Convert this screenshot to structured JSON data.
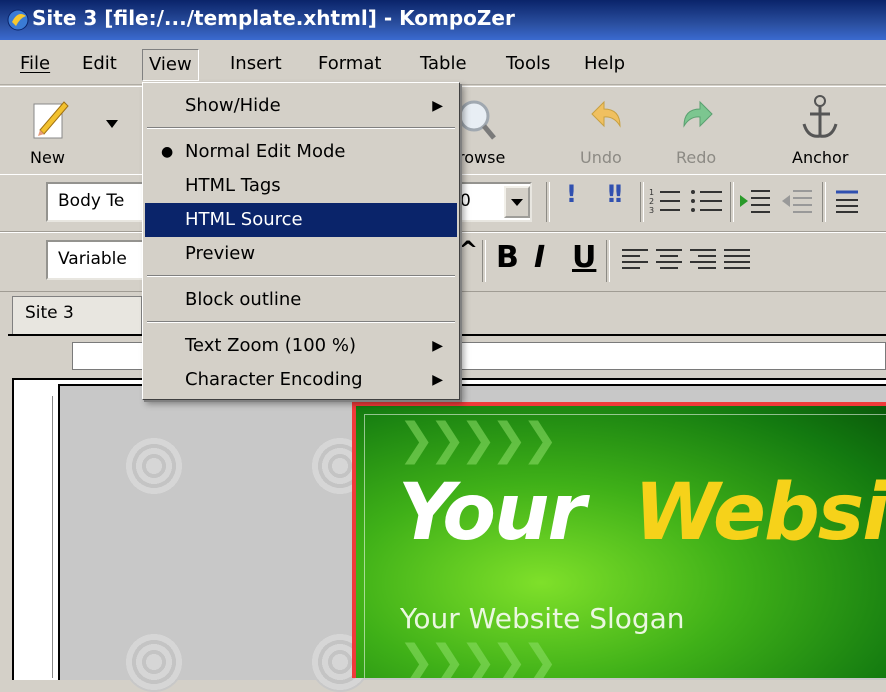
{
  "window": {
    "title": "Site 3 [file:/.../template.xhtml] - KompoZer"
  },
  "menubar": {
    "items": [
      {
        "label": "File",
        "key": "F"
      },
      {
        "label": "Edit",
        "key": "E"
      },
      {
        "label": "View",
        "key": "V"
      },
      {
        "label": "Insert",
        "key": "I"
      },
      {
        "label": "Format",
        "key": "o"
      },
      {
        "label": "Table",
        "key": "b"
      },
      {
        "label": "Tools",
        "key": "T"
      },
      {
        "label": "Help",
        "key": "H"
      }
    ]
  },
  "toolbar": {
    "new_label": "New",
    "browse_label": "rowse",
    "undo_label": "Undo",
    "redo_label": "Redo",
    "anchor_label": "Anchor"
  },
  "format_toolbar": {
    "paragraph_format": "Body Te",
    "font_size": "0",
    "font_family": "Variable"
  },
  "tabs": [
    {
      "label": "Site 3"
    }
  ],
  "view_menu": {
    "items": [
      {
        "label": "Show/Hide",
        "submenu": true
      },
      {
        "label": "Normal Edit Mode",
        "checked": true
      },
      {
        "label": "HTML Tags"
      },
      {
        "label": "HTML Source",
        "highlighted": true
      },
      {
        "label": "Preview"
      },
      {
        "label": "Block outline"
      },
      {
        "label": "Text Zoom (100 %)",
        "submenu": true
      },
      {
        "label": "Character Encoding",
        "submenu": true
      }
    ]
  },
  "page": {
    "banner_title_a": "Your",
    "banner_title_b": "Websi",
    "banner_slogan": "Your Website Slogan"
  },
  "colors": {
    "titlebar": "#0a246a",
    "menu_highlight": "#0a246a",
    "banner_green": "#3fb018",
    "banner_yellow": "#f6d21a",
    "selection_border": "#f03a3a"
  }
}
